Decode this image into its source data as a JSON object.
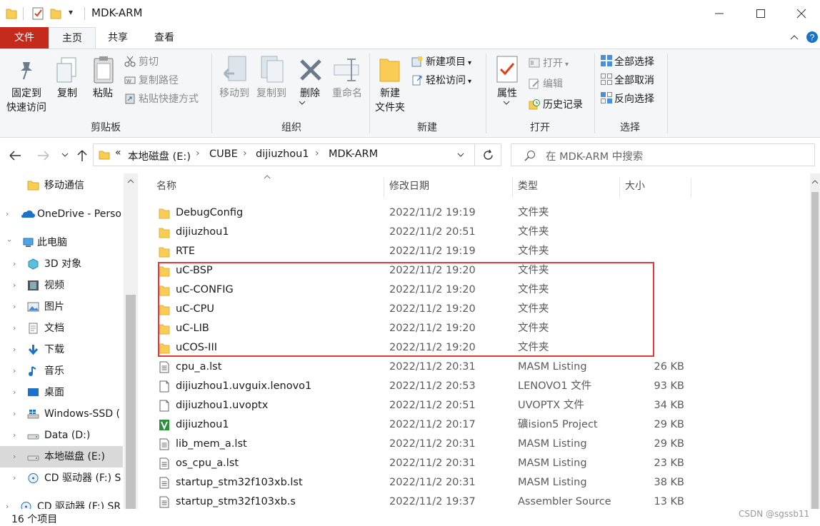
{
  "window": {
    "title": "MDK-ARM",
    "quick_access_dropdown": "▾"
  },
  "ribbon_tabs": [
    "文件",
    "主页",
    "共享",
    "查看"
  ],
  "ribbon": {
    "clipboard": {
      "pin_line1": "固定到",
      "pin_line2": "快速访问",
      "copy": "复制",
      "paste": "粘贴",
      "cut": "剪切",
      "copy_path": "复制路径",
      "paste_shortcut": "粘贴快捷方式",
      "group": "剪贴板"
    },
    "organize": {
      "move_to": "移动到",
      "copy_to": "复制到",
      "delete": "删除",
      "rename": "重命名",
      "group": "组织"
    },
    "new": {
      "new_folder_line1": "新建",
      "new_folder_line2": "文件夹",
      "new_item": "新建项目",
      "easy_access": "轻松访问",
      "group": "新建"
    },
    "open": {
      "properties": "属性",
      "open": "打开",
      "edit": "编辑",
      "history": "历史记录",
      "group": "打开"
    },
    "select": {
      "select_all": "全部选择",
      "select_none": "全部取消",
      "invert": "反向选择",
      "group": "选择"
    }
  },
  "address": {
    "prefix": "«",
    "breadcrumbs": [
      "本地磁盘 (E:)",
      "CUBE",
      "dijiuzhou1",
      "MDK-ARM"
    ],
    "search_placeholder": "在 MDK-ARM 中搜索"
  },
  "nav_pane": [
    {
      "label": "移动通信",
      "icon": "folder-icon"
    },
    {
      "label": "OneDrive - Perso",
      "icon": "onedrive-icon"
    },
    {
      "label": "此电脑",
      "icon": "pc-icon"
    },
    {
      "label": "3D 对象",
      "icon": "3d-objects-icon"
    },
    {
      "label": "视频",
      "icon": "video-icon"
    },
    {
      "label": "图片",
      "icon": "pictures-icon"
    },
    {
      "label": "文档",
      "icon": "documents-icon"
    },
    {
      "label": "下载",
      "icon": "download-icon"
    },
    {
      "label": "音乐",
      "icon": "music-icon"
    },
    {
      "label": "桌面",
      "icon": "desktop-icon"
    },
    {
      "label": "Windows-SSD (",
      "icon": "windows-drive-icon"
    },
    {
      "label": "Data (D:)",
      "icon": "drive-icon"
    },
    {
      "label": "本地磁盘 (E:)",
      "icon": "drive-icon"
    },
    {
      "label": "CD 驱动器 (F:) S",
      "icon": "cd-drive-icon"
    },
    {
      "label": "CD 驱动器 (F:) SR",
      "icon": "cd-drive-icon"
    }
  ],
  "columns": [
    "名称",
    "修改日期",
    "类型",
    "大小"
  ],
  "files": [
    {
      "name": "DebugConfig",
      "date": "2022/11/2 19:19",
      "type": "文件夹",
      "size": "",
      "icon": "folder-icon"
    },
    {
      "name": "dijiuzhou1",
      "date": "2022/11/2 20:51",
      "type": "文件夹",
      "size": "",
      "icon": "folder-icon"
    },
    {
      "name": "RTE",
      "date": "2022/11/2 19:19",
      "type": "文件夹",
      "size": "",
      "icon": "folder-icon"
    },
    {
      "name": "uC-BSP",
      "date": "2022/11/2 19:20",
      "type": "文件夹",
      "size": "",
      "icon": "folder-icon"
    },
    {
      "name": "uC-CONFIG",
      "date": "2022/11/2 19:20",
      "type": "文件夹",
      "size": "",
      "icon": "folder-icon"
    },
    {
      "name": "uC-CPU",
      "date": "2022/11/2 19:20",
      "type": "文件夹",
      "size": "",
      "icon": "folder-icon"
    },
    {
      "name": "uC-LIB",
      "date": "2022/11/2 19:20",
      "type": "文件夹",
      "size": "",
      "icon": "folder-icon"
    },
    {
      "name": "uCOS-III",
      "date": "2022/11/2 19:20",
      "type": "文件夹",
      "size": "",
      "icon": "folder-icon"
    },
    {
      "name": "cpu_a.lst",
      "date": "2022/11/2 20:31",
      "type": "MASM Listing",
      "size": "26 KB",
      "icon": "text-file-icon"
    },
    {
      "name": "dijiuzhou1.uvguix.lenovo1",
      "date": "2022/11/2 20:53",
      "type": "LENOVO1 文件",
      "size": "93 KB",
      "icon": "blank-file-icon"
    },
    {
      "name": "dijiuzhou1.uvoptx",
      "date": "2022/11/2 20:51",
      "type": "UVOPTX 文件",
      "size": "34 KB",
      "icon": "blank-file-icon"
    },
    {
      "name": "dijiuzhou1",
      "date": "2022/11/2 20:17",
      "type": "礦ision5 Project",
      "size": "29 KB",
      "icon": "keil-project-icon"
    },
    {
      "name": "lib_mem_a.lst",
      "date": "2022/11/2 20:31",
      "type": "MASM Listing",
      "size": "29 KB",
      "icon": "text-file-icon"
    },
    {
      "name": "os_cpu_a.lst",
      "date": "2022/11/2 20:31",
      "type": "MASM Listing",
      "size": "23 KB",
      "icon": "text-file-icon"
    },
    {
      "name": "startup_stm32f103xb.lst",
      "date": "2022/11/2 20:31",
      "type": "MASM Listing",
      "size": "38 KB",
      "icon": "text-file-icon"
    },
    {
      "name": "startup_stm32f103xb.s",
      "date": "2022/11/2 19:37",
      "type": "Assembler Source",
      "size": "13 KB",
      "icon": "text-file-icon"
    }
  ],
  "status": {
    "count": "16 个项目",
    "watermark": "CSDN @sgssb11"
  },
  "colors": {
    "file_tab": "#c42b1c",
    "highlight_box": "#e53935",
    "folder": "#f8cc55",
    "accent": "#1a73c8"
  }
}
